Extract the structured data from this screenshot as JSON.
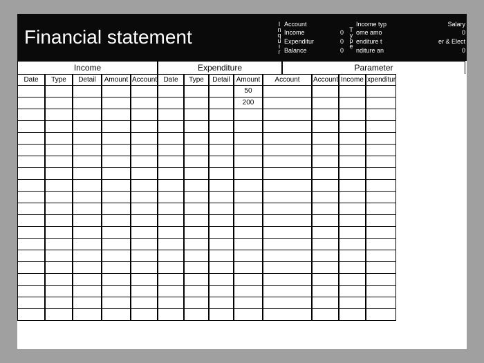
{
  "title": "Financial statement",
  "inquire_label": "Inquir",
  "type_label": "Type",
  "info1": {
    "account_label": "Account",
    "account_value": "",
    "income_label": "Income",
    "income_value": "0",
    "expenditure_label": "Expenditur",
    "expenditure_value": "0",
    "balance_label": "Balance",
    "balance_value": "0"
  },
  "info2": {
    "income_type_label": "Income typ",
    "income_type_value": "Salary",
    "income_amo_label": "ome amo",
    "income_amo_value": "0",
    "expenditure_type_label": "enditure t",
    "expenditure_type_value": "er & Elect",
    "expenditure_amo_label": "nditure an",
    "expenditure_amo_value": "0"
  },
  "sections": {
    "income": "Income",
    "expenditure": "Expenditure",
    "parameter": "Parameter"
  },
  "columns": [
    "Date",
    "Type",
    "Detail",
    "Amount",
    "Account",
    "Date",
    "Type",
    "Detail",
    "Amount",
    "Account",
    "Account",
    "Income",
    "xpenditur"
  ],
  "amounts": {
    "row0": "50",
    "row1": "200"
  },
  "num_rows": 20
}
